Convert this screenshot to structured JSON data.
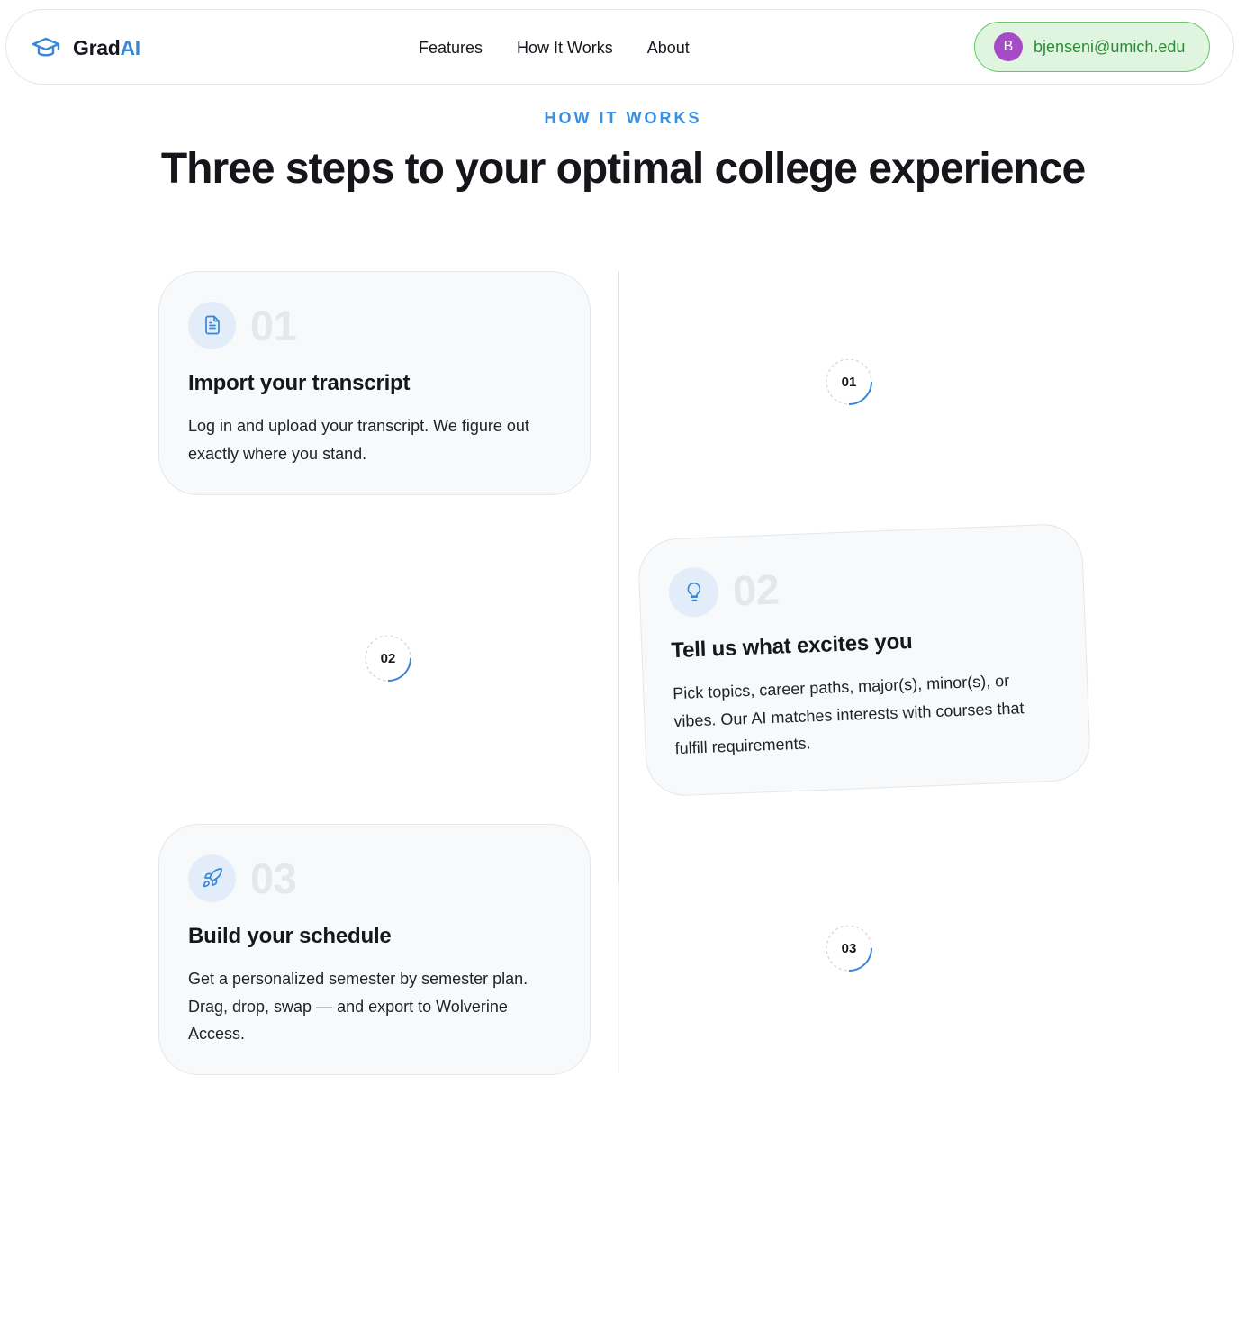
{
  "navbar": {
    "brand_part1": "Grad",
    "brand_part2": "AI",
    "logo_icon": "graduation-cap-icon",
    "links": [
      "Features",
      "How It Works",
      "About"
    ],
    "user": {
      "avatar_initial": "B",
      "email": "bjenseni@umich.edu"
    }
  },
  "section": {
    "eyebrow": "HOW IT WORKS",
    "headline": "Three steps to your optimal college experience"
  },
  "steps": [
    {
      "number": "01",
      "icon": "document-icon",
      "title": "Import your transcript",
      "body": "Log in and upload your transcript. We figure out exactly where you stand."
    },
    {
      "number": "02",
      "icon": "lightbulb-icon",
      "title": "Tell us what excites you",
      "body": "Pick topics, career paths, major(s), minor(s), or vibes. Our AI matches interests with courses that fulfill requirements."
    },
    {
      "number": "03",
      "icon": "rocket-icon",
      "title": "Build your schedule",
      "body": "Get a personalized semester by semester plan. Drag, drop, swap — and export to Wolverine Access."
    }
  ],
  "colors": {
    "accent": "#3a86d6",
    "pill_bg": "#dff5df",
    "pill_border": "#62c765",
    "avatar": "#a64bc6",
    "card_bg": "#f8f9fa",
    "step_number": "#e4e8ec"
  }
}
